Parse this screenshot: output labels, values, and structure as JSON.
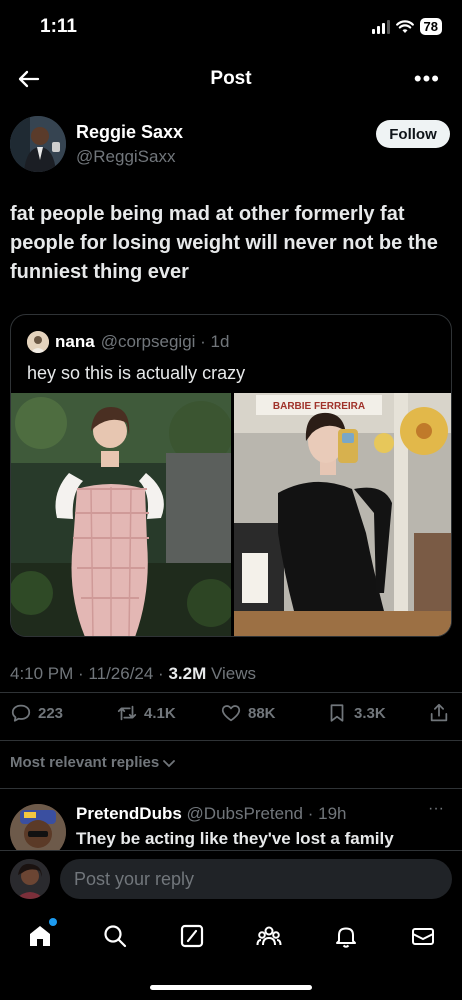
{
  "status": {
    "time": "1:11",
    "battery": "78"
  },
  "nav": {
    "title": "Post",
    "more": "•••"
  },
  "author": {
    "name": "Reggie Saxx",
    "handle": "@ReggiSaxx",
    "follow_label": "Follow"
  },
  "tweet": {
    "text": "fat people being mad at other formerly fat people for losing weight will never not be the funniest thing ever"
  },
  "quote": {
    "name": "nana",
    "handle": "@corpsegigi · 1d",
    "text": "hey so this is actually crazy",
    "sign_text": "BARBIE FERREIRA"
  },
  "meta": {
    "datetime": "4:10 PM · 11/26/24 · ",
    "views_count": "3.2M",
    "views_label": " Views"
  },
  "actions": {
    "replies": "223",
    "reposts": "4.1K",
    "likes": "88K",
    "bookmarks": "3.3K"
  },
  "sort": {
    "label": "Most relevant replies"
  },
  "reply": {
    "name": "PretendDubs",
    "handle": "@DubsPretend · 19h",
    "text": "They be acting like they've lost a family",
    "more": "···"
  },
  "composer": {
    "placeholder": "Post your reply"
  },
  "colors": {
    "background": "#000000",
    "text": "#e7e9ea",
    "muted": "#71767b",
    "accent": "#1d9bf0"
  }
}
